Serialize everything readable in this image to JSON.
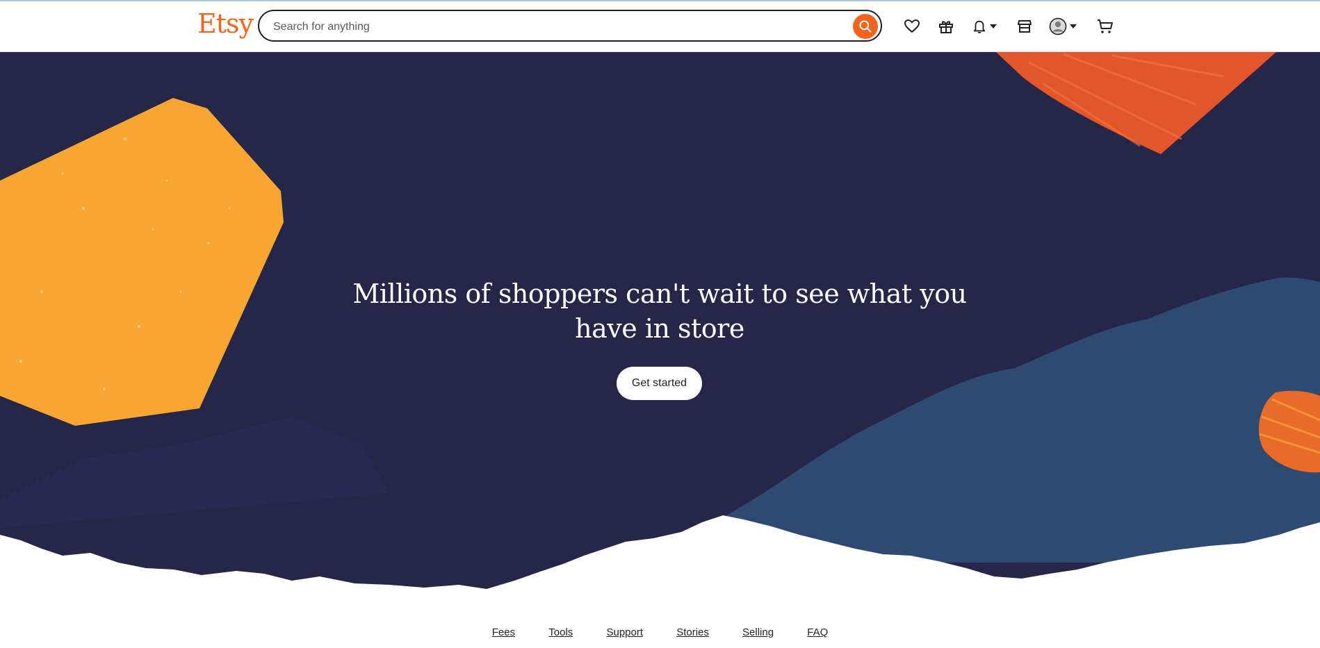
{
  "header": {
    "logo": "Etsy",
    "search": {
      "placeholder": "Search for anything"
    },
    "icons": [
      "heart-icon",
      "gift-icon",
      "bell-icon",
      "shop-icon",
      "user-avatar-icon",
      "cart-icon"
    ]
  },
  "hero": {
    "headline": "Millions of shoppers can't wait to see what you have in store",
    "cta": "Get started"
  },
  "footer": {
    "links": [
      "Fees",
      "Tools",
      "Support",
      "Stories",
      "Selling",
      "FAQ"
    ]
  },
  "colors": {
    "brand": "#f1641e",
    "hero_bg": "#262649",
    "wave_blue": "#2f4a72",
    "yellow_shape": "#f7a731",
    "orange_shape": "#e3562b"
  }
}
